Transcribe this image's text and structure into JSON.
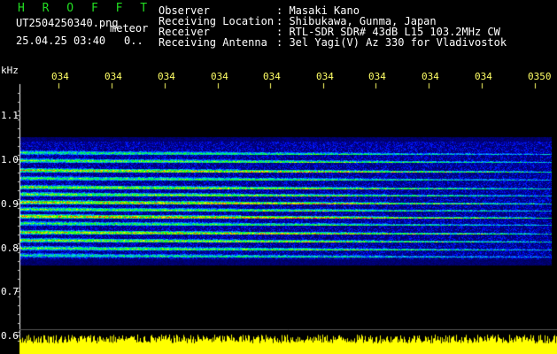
{
  "header": {
    "app_title": "H R O F F T",
    "filename": "UT2504250340.png",
    "meteor_label": "meteor",
    "datetime": "25.04.25 03:40",
    "count": "0..",
    "fields": [
      {
        "label": "Observer",
        "value": ": Masaki Kano"
      },
      {
        "label": "Receiving Location",
        "value": ": Shibukawa, Gunma, Japan"
      },
      {
        "label": "Receiver",
        "value": ": RTL-SDR SDR# 43dB L15 103.2MHz CW"
      },
      {
        "label": "Receiving Antenna",
        "value": ": 3el Yagi(V) Az 330 for Vladivostok"
      }
    ]
  },
  "y_axis": {
    "unit": "kHz",
    "ticks": [
      "1.1",
      "1.0",
      "0.9",
      "0.8",
      "0.7",
      "0.6"
    ]
  },
  "x_axis": {
    "ticks": [
      "034",
      "034",
      "034",
      "034",
      "034",
      "034",
      "034",
      "034",
      "034",
      "0350"
    ]
  },
  "colors": {
    "background": "#000000",
    "title": "#22dd22",
    "tick": "#ffff66",
    "signal": "#ffff00"
  }
}
